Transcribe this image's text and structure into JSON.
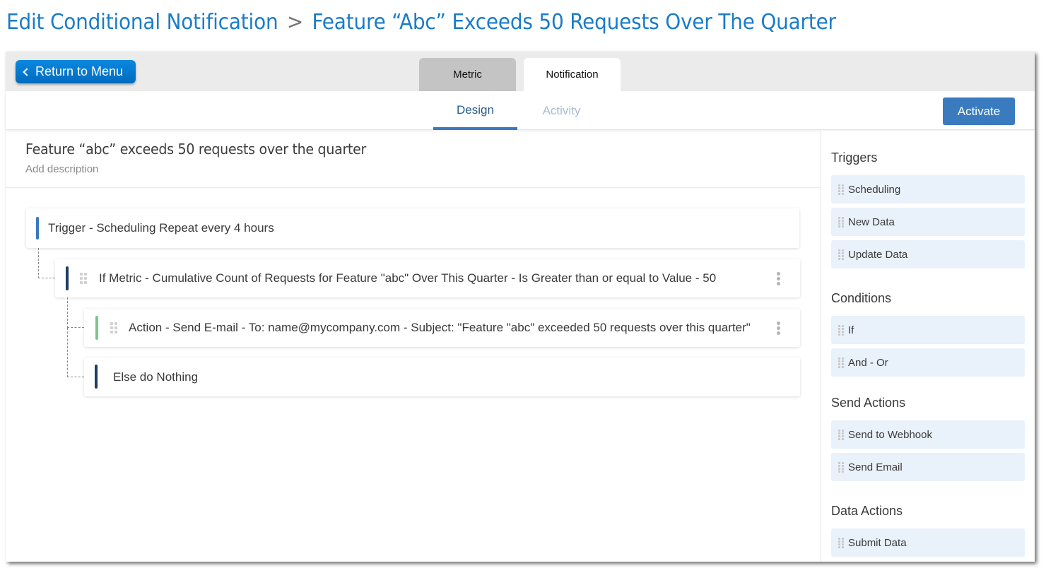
{
  "page": {
    "title_prefix": "Edit Conditional Notification",
    "title_separator": ">",
    "title_subject": "Feature “Abc” Exceeds 50 Requests Over The Quarter"
  },
  "topbar": {
    "return_label": "Return to Menu",
    "tabs": [
      {
        "label": "Metric",
        "active": false
      },
      {
        "label": "Notification",
        "active": true
      }
    ]
  },
  "subbar": {
    "tabs": [
      {
        "label": "Design",
        "active": true
      },
      {
        "label": "Activity",
        "active": false
      }
    ],
    "activate_label": "Activate"
  },
  "notification": {
    "name": "Feature “abc” exceeds 50 requests over the quarter",
    "description_placeholder": "Add description"
  },
  "flow": {
    "trigger": "Trigger - Scheduling  Repeat every 4 hours",
    "condition": "If Metric - Cumulative Count of Requests for Feature \"abc\" Over This Quarter - Is Greater than or equal to Value - 50",
    "action": "Action  - Send E-mail - To: name@mycompany.com - Subject: \"Feature \"abc\" exceeded 50 requests over this quarter\"",
    "else": "Else do Nothing"
  },
  "colors": {
    "title": "#1a7cc9",
    "accent": "#3a7bc0",
    "trigger_bar": "#3a78c0",
    "condition_bar": "#1f3e63",
    "action_bar": "#7cc68c",
    "palette_bg": "#e9f1fa"
  },
  "sidebar": {
    "sections": [
      {
        "title": "Triggers",
        "items": [
          "Scheduling",
          "New Data",
          "Update Data"
        ]
      },
      {
        "title": "Conditions",
        "items": [
          "If",
          "And - Or"
        ]
      },
      {
        "title": "Send Actions",
        "items": [
          "Send to Webhook",
          "Send Email"
        ]
      },
      {
        "title": "Data Actions",
        "items": [
          "Submit Data"
        ]
      }
    ]
  }
}
